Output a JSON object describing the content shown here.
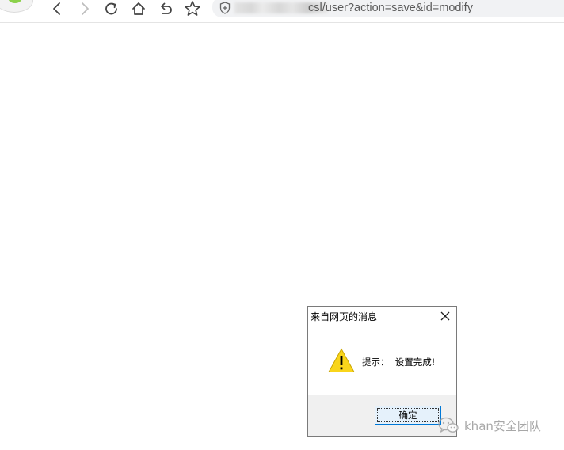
{
  "browser": {
    "url": "csl/user?action=save&id=modify"
  },
  "dialog": {
    "title": "来自网页的消息",
    "message": "提示：  设置完成!",
    "ok_label": "确定"
  },
  "watermark": {
    "text": "khan安全团队"
  },
  "colors": {
    "button_border": "#0078d7",
    "button_fill": "#e5f1fb",
    "footer": "#f0f0f0",
    "warning": "#f9d51b"
  }
}
